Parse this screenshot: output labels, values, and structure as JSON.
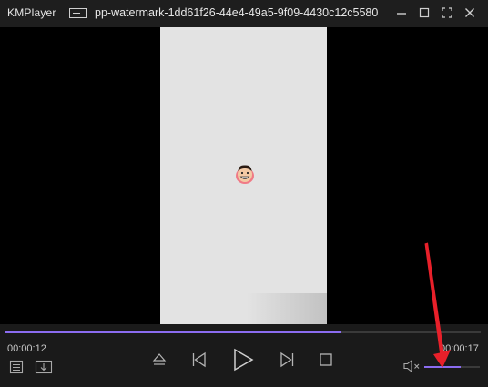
{
  "app": {
    "name": "KMPlayer",
    "file_title": "pp-watermark-1dd61f26-44e4-49a5-9f09-4430c12c5580"
  },
  "playback": {
    "elapsed": "00:00:12",
    "total": "00:00:17",
    "progress_fraction": 0.705,
    "volume_fraction": 0.66
  },
  "colors": {
    "accent": "#8b6cf0",
    "annotation_arrow": "#e8202a"
  },
  "icons": {
    "window": [
      "minimize-icon",
      "restore-icon",
      "fullscreen-icon",
      "close-icon"
    ],
    "controls": [
      "playlist-icon",
      "download-icon",
      "eject-icon",
      "previous-icon",
      "play-icon",
      "next-icon",
      "stop-icon",
      "mute-icon"
    ]
  }
}
